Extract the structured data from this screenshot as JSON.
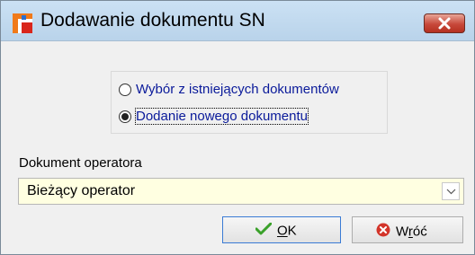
{
  "window": {
    "title": "Dodawanie dokumentu SN"
  },
  "options": [
    {
      "label": "Wybór z istniejących dokumentów",
      "selected": false
    },
    {
      "label": "Dodanie nowego dokumentu",
      "selected": true
    }
  ],
  "operator": {
    "label": "Dokument operatora",
    "value": "Bieżący operator"
  },
  "buttons": {
    "ok_mnemonic": "O",
    "ok_rest": "K",
    "back_start": "W",
    "back_mnemonic": "r",
    "back_rest": "óć"
  },
  "colors": {
    "titlebar": "#c6ddf1",
    "combo_bg": "#ffffe1",
    "radio_text": "#0a1a9a",
    "close_button": "#c7483a"
  },
  "icons": {
    "app": "app-logo-icon",
    "close": "close-icon",
    "dropdown": "chevron-down-icon",
    "ok": "checkmark-icon",
    "back": "cancel-icon"
  }
}
